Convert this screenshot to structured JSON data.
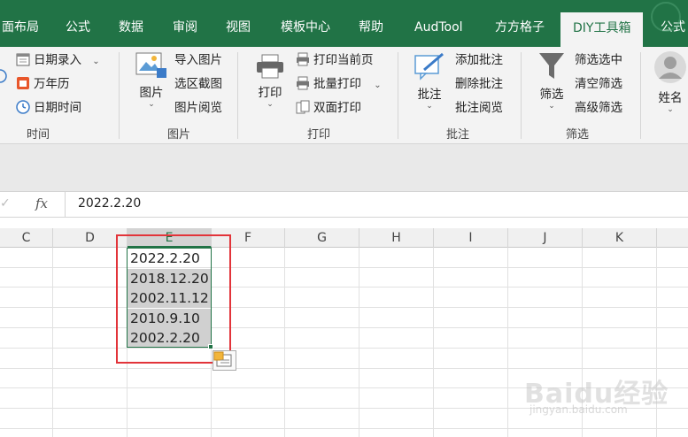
{
  "tabs": [
    {
      "label": "面布局"
    },
    {
      "label": "公式"
    },
    {
      "label": "数据"
    },
    {
      "label": "审阅"
    },
    {
      "label": "视图"
    },
    {
      "label": "模板中心"
    },
    {
      "label": "帮助"
    },
    {
      "label": "AudTool"
    },
    {
      "label": "方方格子"
    },
    {
      "label": "DIY工具箱"
    },
    {
      "label": "公式"
    }
  ],
  "ribbon": {
    "time": {
      "title": "时间",
      "items": [
        "日期录入",
        "万年历",
        "日期时间"
      ]
    },
    "picture": {
      "title": "图片",
      "big_label": "图片",
      "items": [
        "导入图片",
        "选区截图",
        "图片阅览"
      ]
    },
    "print": {
      "title": "打印",
      "big_label": "打印",
      "items": [
        "打印当前页",
        "批量打印",
        "双面打印"
      ]
    },
    "comment": {
      "title": "批注",
      "big_label": "批注",
      "items": [
        "添加批注",
        "删除批注",
        "批注阅览"
      ]
    },
    "filter": {
      "title": "筛选",
      "big_label": "筛选",
      "items": [
        "筛选选中",
        "清空筛选",
        "高级筛选"
      ]
    },
    "name": {
      "big_label": "姓名"
    }
  },
  "formula_bar": {
    "cancel_icon": "✓",
    "fx": "fx",
    "value": "2022.2.20"
  },
  "columns": [
    "C",
    "D",
    "E",
    "F",
    "G",
    "H",
    "I",
    "J",
    "K"
  ],
  "selected_column": "E",
  "cells": [
    "2022.2.20",
    "2018.12.20",
    "2002.11.12",
    "2010.9.10",
    "2002.2.20"
  ],
  "watermark": {
    "brand": "Baidu经验",
    "url": "jingyan.baidu.com"
  },
  "colors": {
    "accent": "#217346",
    "highlight": "#e2343a"
  }
}
